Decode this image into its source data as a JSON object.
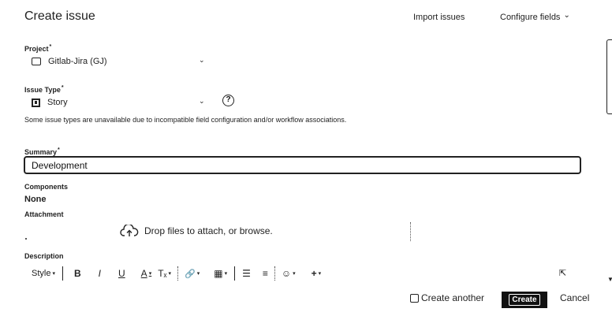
{
  "header": {
    "title": "Create issue",
    "import_label": "Import issues",
    "configure_label": "Configure fields",
    "configure_caret": "⌄"
  },
  "project": {
    "label": "Project",
    "required_mark": "*",
    "value": "Gitlab-Jira (GJ)",
    "caret": "⌄",
    "icon": "project-icon"
  },
  "issue_type": {
    "label": "Issue Type",
    "required_mark": "*",
    "value": "Story",
    "caret": "⌄",
    "icon": "story-icon",
    "help": "?",
    "note": "Some issue types are unavailable due to incompatible field configuration and/or workflow associations."
  },
  "summary": {
    "label": "Summary",
    "required_mark": "*",
    "value": "Development"
  },
  "components": {
    "label": "Components",
    "value": "None"
  },
  "attachment": {
    "label": "Attachment",
    "dropzone_text": "Drop files to attach, or browse.",
    "icon": "upload-cloud-icon"
  },
  "description": {
    "label": "Description",
    "toolbar": {
      "style": "Style",
      "bold": "B",
      "italic": "I",
      "underline": "U",
      "color": "A",
      "clear_format": "Tₓ",
      "link": "🔗",
      "table": "▦",
      "bullet_list": "☰",
      "numbered_list": "≡",
      "emoji": "☺",
      "insert": "+",
      "caret": "▾",
      "collapse": "⇱"
    }
  },
  "footer": {
    "create_another": "Create another",
    "create_label": "Create",
    "cancel_label": "Cancel"
  }
}
